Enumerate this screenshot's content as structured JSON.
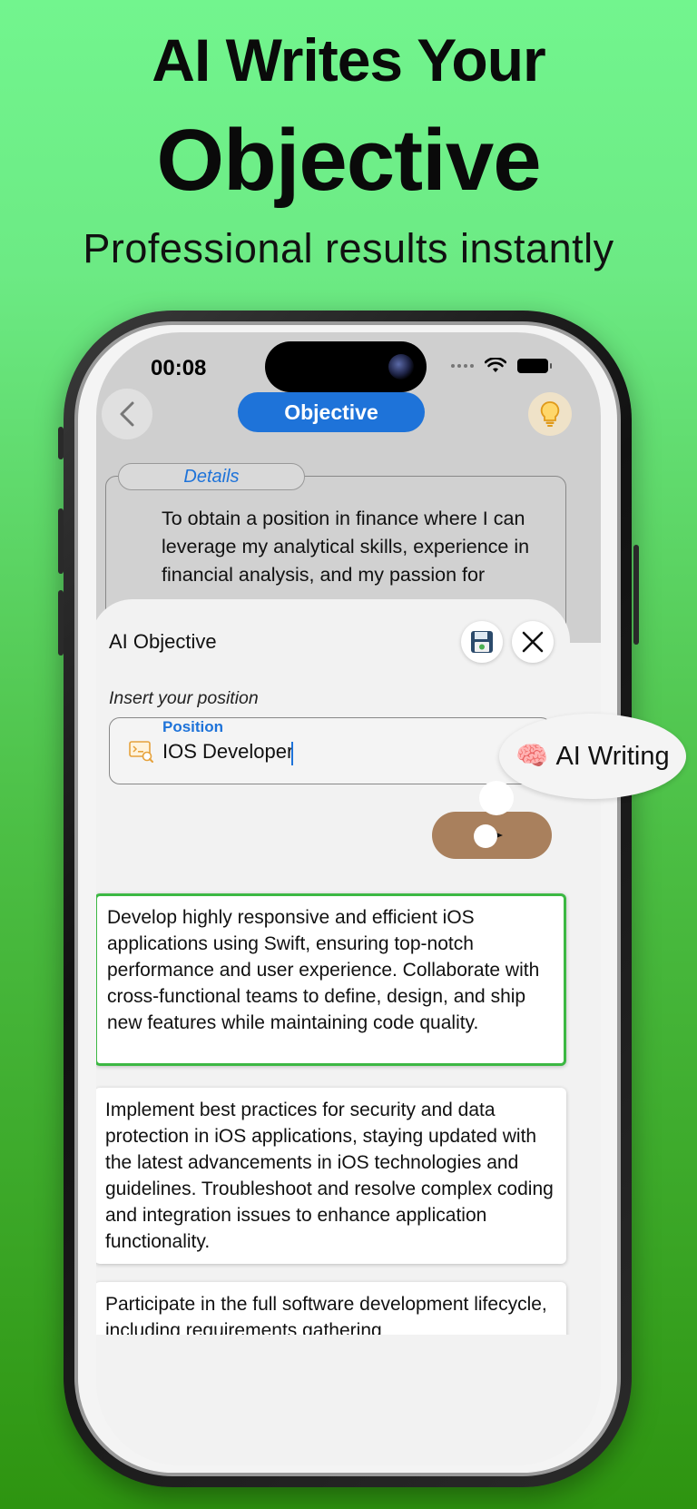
{
  "headline": {
    "line1": "AI Writes Your",
    "line2": "Objective",
    "subtitle": "Professional results instantly"
  },
  "status_bar": {
    "time": "00:08"
  },
  "nav": {
    "title": "Objective"
  },
  "details": {
    "tab_label": "Details",
    "text": "To obtain a position in finance where I can leverage my analytical skills, experience in financial analysis, and my passion for problem-solving to"
  },
  "sheet": {
    "title": "AI Objective",
    "insert_label": "Insert your position",
    "position_label": "Position",
    "position_value": "IOS Developer"
  },
  "results": [
    "Develop highly responsive and efficient iOS applications using Swift, ensuring top-notch performance and user experience. Collaborate with cross-functional teams to define, design, and ship new features while maintaining code quality.",
    "Implement best practices for security and data protection in iOS applications, staying updated with the latest advancements in iOS technologies and guidelines. Troubleshoot and resolve complex coding and integration issues to enhance application functionality.",
    "Participate in the full software development lifecycle, including requirements gathering"
  ],
  "ai_bubble": {
    "emoji": "🧠",
    "label": "AI Writing"
  },
  "colors": {
    "accent_blue": "#1e73d9",
    "send_button": "#a9805d",
    "selected_border": "#3cb843",
    "background_top": "#72f58e",
    "background_bottom": "#2e9410"
  },
  "icons": {
    "back": "chevron-left-icon",
    "tips": "lightbulb-icon",
    "save": "floppy-disk-icon",
    "close": "close-icon",
    "position": "developer-screen-icon",
    "send": "paper-plane-icon"
  }
}
